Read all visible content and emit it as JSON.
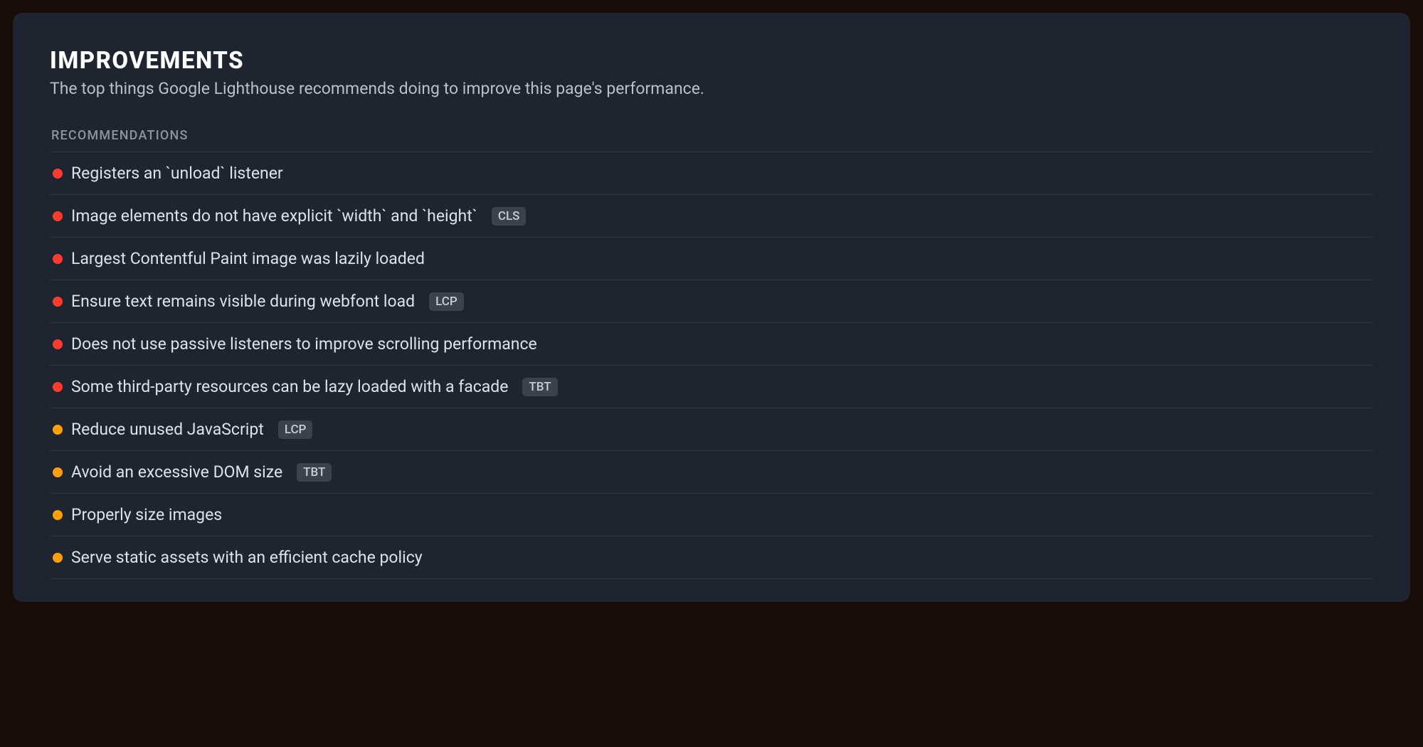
{
  "header": {
    "title": "IMPROVEMENTS",
    "subtitle": "The top things Google Lighthouse recommends doing to improve this page's performance."
  },
  "section_label": "RECOMMENDATIONS",
  "items": [
    {
      "severity": "red",
      "text": "Registers an `unload` listener",
      "badge": null
    },
    {
      "severity": "red",
      "text": "Image elements do not have explicit `width` and `height`",
      "badge": "CLS"
    },
    {
      "severity": "red",
      "text": "Largest Contentful Paint image was lazily loaded",
      "badge": null
    },
    {
      "severity": "red",
      "text": "Ensure text remains visible during webfont load",
      "badge": "LCP"
    },
    {
      "severity": "red",
      "text": "Does not use passive listeners to improve scrolling performance",
      "badge": null
    },
    {
      "severity": "red",
      "text": "Some third-party resources can be lazy loaded with a facade",
      "badge": "TBT"
    },
    {
      "severity": "orange",
      "text": "Reduce unused JavaScript",
      "badge": "LCP"
    },
    {
      "severity": "orange",
      "text": "Avoid an excessive DOM size",
      "badge": "TBT"
    },
    {
      "severity": "orange",
      "text": "Properly size images",
      "badge": null
    },
    {
      "severity": "orange",
      "text": "Serve static assets with an efficient cache policy",
      "badge": null
    }
  ]
}
